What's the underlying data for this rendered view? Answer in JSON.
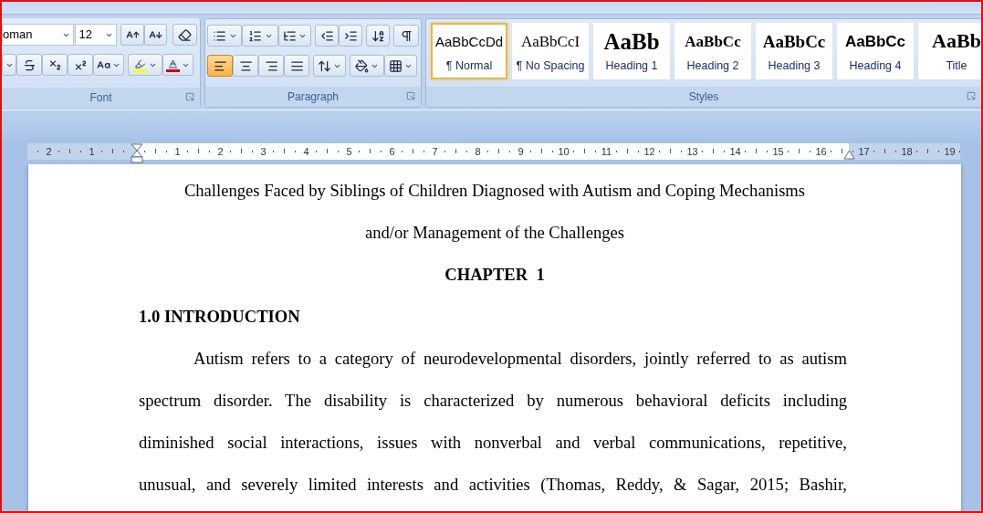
{
  "ribbon": {
    "font_group": {
      "label": "Font",
      "font_name": "oman",
      "font_size": "12"
    },
    "paragraph_group": {
      "label": "Paragraph",
      "alignments": [
        {
          "kind": "left",
          "selected": true
        },
        {
          "kind": "center",
          "selected": false
        },
        {
          "kind": "right",
          "selected": false
        },
        {
          "kind": "justify",
          "selected": false
        }
      ]
    },
    "styles_group": {
      "label": "Styles",
      "styles": [
        {
          "kind": "normal",
          "preview": "AaBbCcDd",
          "label": "¶ Normal",
          "selected": true
        },
        {
          "kind": "no_spacing",
          "preview": "AaBbCcI",
          "label": "¶ No Spacing",
          "selected": false
        },
        {
          "kind": "heading_1",
          "preview": "AaBb",
          "label": "Heading 1",
          "selected": false
        },
        {
          "kind": "heading_2",
          "preview": "AaBbCc",
          "label": "Heading 2",
          "selected": false
        },
        {
          "kind": "heading_3",
          "preview": "AaBbCc",
          "label": "Heading 3",
          "selected": false
        },
        {
          "kind": "heading_4",
          "preview": "AaBbCc",
          "label": "Heading 4",
          "selected": false
        },
        {
          "kind": "title",
          "preview": "AaBb",
          "label": "Title",
          "selected": false
        }
      ]
    }
  },
  "ruler": {
    "left_labels": [
      "2",
      "1"
    ],
    "labels": [
      "1",
      "2",
      "3",
      "4",
      "5",
      "6",
      "7",
      "8",
      "9",
      "10",
      "11",
      "12",
      "13",
      "14",
      "15",
      "16",
      "17",
      "18",
      "19"
    ]
  },
  "document": {
    "title_lines": [
      "Challenges Faced by Siblings of Children Diagnosed with Autism and Coping Mechanisms",
      "and/or Management of the Challenges"
    ],
    "chapter": "CHAPTER  1",
    "heading": "1.0 INTRODUCTION",
    "paragraph_lines": [
      "Autism refers to a category of neurodevelopmental disorders, jointly referred to as autism",
      "spectrum disorder. The disability is characterized by numerous behavioral deficits including",
      "diminished social interactions, issues with nonverbal and verbal communications, repetitive,",
      "unusual, and severely limited interests and activities (Thomas, Reddy, & Sagar, 2015; Bashir,"
    ]
  }
}
